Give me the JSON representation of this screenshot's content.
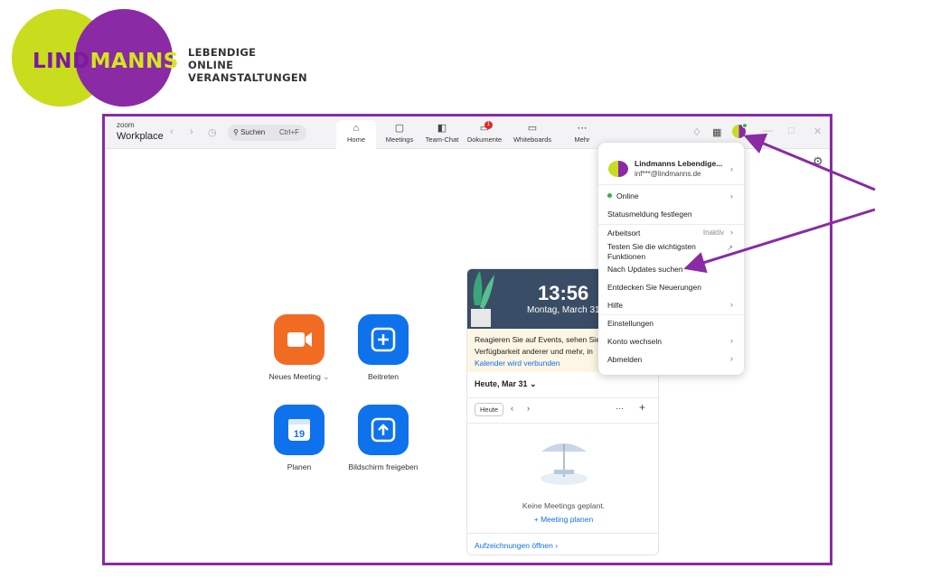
{
  "logo": {
    "word_part1": "LIND",
    "word_part2": "MANNS",
    "tagline_line1": "LEBENDIGE",
    "tagline_line2": "ONLINE",
    "tagline_line3": "VERANSTALTUNGEN",
    "colors": {
      "lime": "#c9dc1e",
      "purple": "#8a2aa5"
    }
  },
  "app": {
    "brand_small": "zoom",
    "brand_name": "Workplace",
    "search": {
      "label": "Suchen",
      "shortcut": "Ctrl+F"
    },
    "tabs": [
      {
        "label": "Home",
        "icon": "home-icon",
        "active": true
      },
      {
        "label": "Meetings",
        "icon": "video-icon"
      },
      {
        "label": "Team-Chat",
        "icon": "chat-icon"
      },
      {
        "label": "Dokumente",
        "icon": "document-icon",
        "badge": "1"
      },
      {
        "label": "Whiteboards",
        "icon": "whiteboard-icon"
      },
      {
        "label": "Mehr",
        "icon": "more-icon"
      }
    ],
    "accent_color": "#0e72ed",
    "frame_color": "#8a2aa5"
  },
  "actions": [
    {
      "label": "Neues Meeting",
      "color": "#f26b23",
      "icon": "video-camera-icon"
    },
    {
      "label": "Beitreten",
      "color": "#0e72ed",
      "icon": "plus-icon"
    },
    {
      "label": "Planen",
      "color": "#0e72ed",
      "icon": "calendar-icon",
      "day": "19"
    },
    {
      "label": "Bildschirm freigeben",
      "color": "#0e72ed",
      "icon": "share-up-icon"
    }
  ],
  "calendar": {
    "time": "13:56",
    "date": "Montag, March 31",
    "banner_line1": "Reagieren Sie auf Events, sehen Sie",
    "banner_line2": "Verfügbarkeit anderer und mehr, in",
    "banner_link": "Kalender wird verbunden",
    "today_label": "Heute, Mar 31",
    "today_button": "Heute",
    "empty_text": "Keine Meetings geplant.",
    "plan_link": "+ Meeting planen",
    "recordings_link": "Aufzeichnungen öffnen"
  },
  "menu": {
    "name": "Lindmanns Lebendige...",
    "email": "inf***@lindmanns.de",
    "status": "Online",
    "items": {
      "status_message": "Statusmeldung festlegen",
      "workplace": "Arbeitsort",
      "workplace_value": "Inaktiv",
      "test_line1": "Testen Sie die wichtigsten",
      "test_line2": "Funktionen",
      "updates": "Nach Updates suchen",
      "discover": "Entdecken Sie Neuerungen",
      "help": "Hilfe",
      "settings": "Einstellungen",
      "switch_account": "Konto wechseln",
      "logout": "Abmelden"
    }
  }
}
